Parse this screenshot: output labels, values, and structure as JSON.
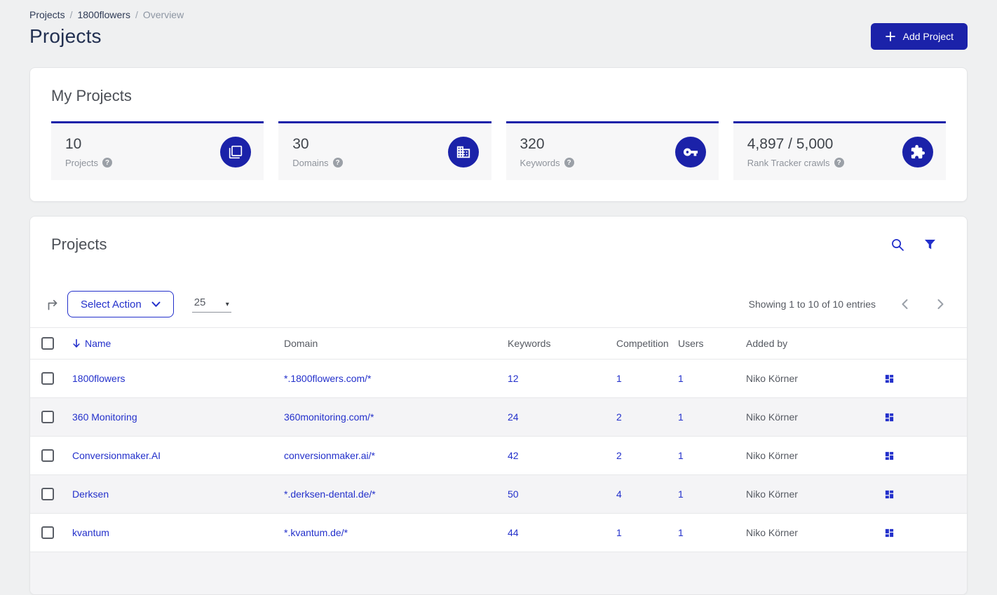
{
  "colors": {
    "primary": "#1b22a9",
    "link": "#2330cb",
    "heading": "#223051"
  },
  "header": {
    "breadcrumb": {
      "items": [
        "Projects",
        "1800flowers",
        "Overview"
      ],
      "separator": "/"
    },
    "title": "Projects",
    "add_project_label": "Add Project"
  },
  "stats": {
    "title": "My Projects",
    "help_glyph": "?",
    "tiles": [
      {
        "value": "10",
        "label": "Projects",
        "icon": "projects-copy-icon"
      },
      {
        "value": "30",
        "label": "Domains",
        "icon": "building-icon"
      },
      {
        "value": "320",
        "label": "Keywords",
        "icon": "key-icon"
      },
      {
        "value": "4,897 / 5,000",
        "label": "Rank Tracker crawls",
        "icon": "puzzle-icon"
      }
    ]
  },
  "projects": {
    "title": "Projects",
    "toolbar": {
      "select_action_label": "Select Action",
      "page_size_value": "25",
      "page_size_caret": "▾",
      "showing_text": "Showing 1 to 10 of 10 entries"
    },
    "table": {
      "headers": {
        "name": "Name",
        "domain": "Domain",
        "keywords": "Keywords",
        "competition": "Competition",
        "users": "Users",
        "added_by": "Added by"
      },
      "rows": [
        {
          "name": "1800flowers",
          "domain": "*.1800flowers.com/*",
          "keywords": "12",
          "competition": "1",
          "users": "1",
          "added_by": "Niko Körner"
        },
        {
          "name": "360 Monitoring",
          "domain": "360monitoring.com/*",
          "keywords": "24",
          "competition": "2",
          "users": "1",
          "added_by": "Niko Körner"
        },
        {
          "name": "Conversionmaker.AI",
          "domain": "conversionmaker.ai/*",
          "keywords": "42",
          "competition": "2",
          "users": "1",
          "added_by": "Niko Körner"
        },
        {
          "name": "Derksen",
          "domain": "*.derksen-dental.de/*",
          "keywords": "50",
          "competition": "4",
          "users": "1",
          "added_by": "Niko Körner"
        },
        {
          "name": "kvantum",
          "domain": "*.kvantum.de/*",
          "keywords": "44",
          "competition": "1",
          "users": "1",
          "added_by": "Niko Körner"
        }
      ]
    }
  }
}
